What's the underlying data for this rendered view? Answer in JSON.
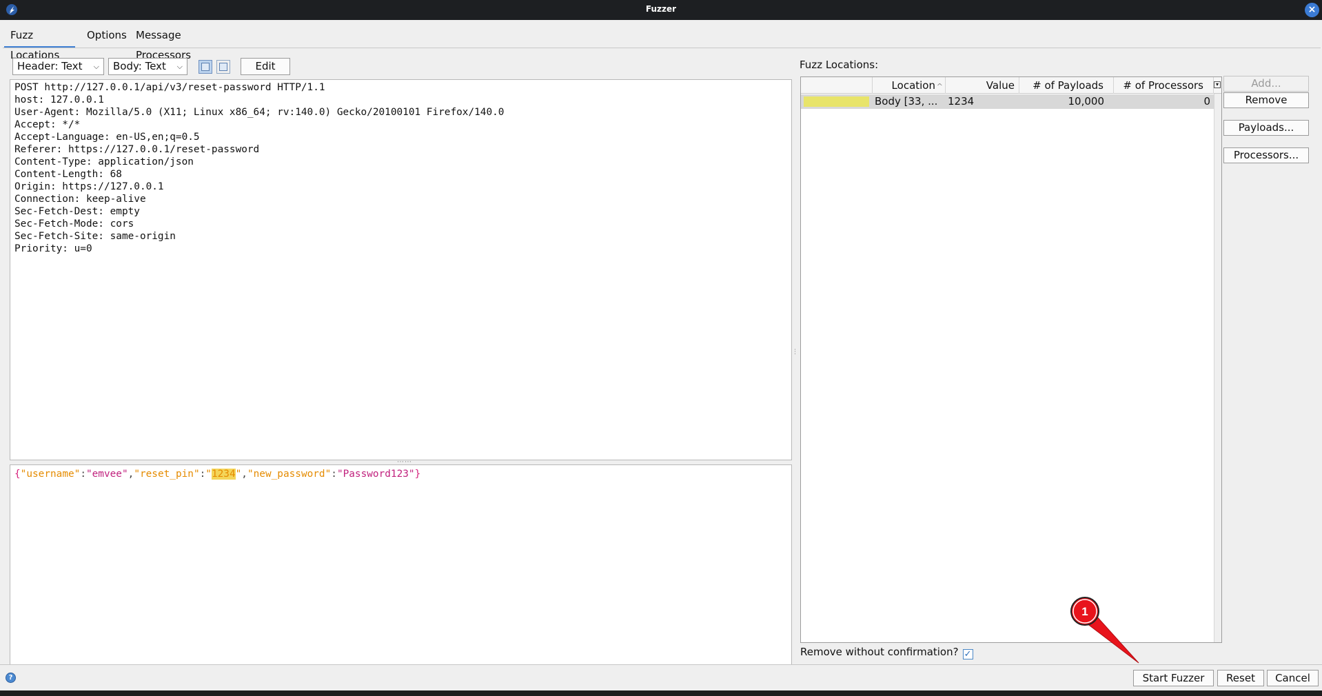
{
  "window": {
    "title": "Fuzzer",
    "app_icon": "zap-logo-icon",
    "close_icon": "close-icon"
  },
  "tabs": [
    {
      "label": "Fuzz Locations",
      "active": true
    },
    {
      "label": "Options",
      "active": false
    },
    {
      "label": "Message Processors",
      "active": false
    }
  ],
  "toolbar": {
    "header_view": "Header: Text",
    "body_view": "Body: Text",
    "edit_label": "Edit",
    "layout_icons": [
      "split-vertical-icon",
      "split-horizontal-icon"
    ]
  },
  "request_header_lines": [
    "POST http://127.0.0.1/api/v3/reset-password HTTP/1.1",
    "host: 127.0.0.1",
    "User-Agent: Mozilla/5.0 (X11; Linux x86_64; rv:140.0) Gecko/20100101 Firefox/140.0",
    "Accept: */*",
    "Accept-Language: en-US,en;q=0.5",
    "Referer: https://127.0.0.1/reset-password",
    "Content-Type: application/json",
    "Content-Length: 68",
    "Origin: https://127.0.0.1",
    "Connection: keep-alive",
    "Sec-Fetch-Dest: empty",
    "Sec-Fetch-Mode: cors",
    "Sec-Fetch-Site: same-origin",
    "Priority: u=0"
  ],
  "request_body": {
    "open_brace": "{",
    "close_brace": "}",
    "colon": ":",
    "comma": ",",
    "k1": "\"username\"",
    "v1": "\"emvee\"",
    "k2": "\"reset_pin\"",
    "v2_open": "\"",
    "v2_highlight": "1234",
    "v2_close": "\"",
    "k3": "\"new_password\"",
    "v3": "\"Password123\""
  },
  "fuzz_locations": {
    "label": "Fuzz Locations:",
    "columns": [
      "Location",
      "Value",
      "# of Payloads",
      "# of Processors"
    ],
    "sort_indicator": "^",
    "rows": [
      {
        "color": "#e8e46a",
        "location": "Body [33, ...",
        "value": "1234",
        "payloads": "10,000",
        "processors": "0"
      }
    ]
  },
  "side_buttons": {
    "add": "Add...",
    "remove": "Remove",
    "payloads": "Payloads...",
    "processors": "Processors..."
  },
  "remove_without_confirmation": {
    "label": "Remove without confirmation?",
    "checked": true,
    "check_mark": "✓"
  },
  "bottom_buttons": {
    "start": "Start Fuzzer",
    "reset": "Reset",
    "cancel": "Cancel"
  },
  "help_icon": "help-icon",
  "annotation": {
    "marker_number": "1",
    "color": "#e8141c"
  }
}
